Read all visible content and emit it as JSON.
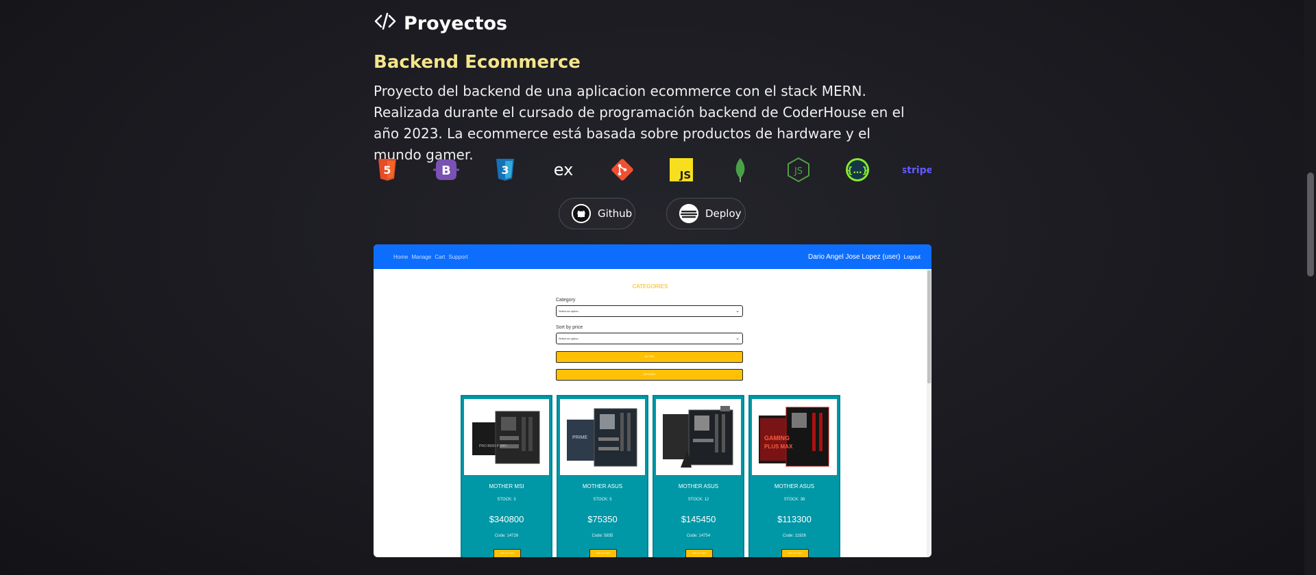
{
  "section": {
    "title": "Proyectos",
    "icon": "code-icon"
  },
  "project": {
    "title": "Backend Ecommerce",
    "description": "Proyecto del backend de una aplicacion ecommerce con el stack MERN. Realizada durante el cursado de programación backend de CoderHouse en el año 2023. La ecommerce está basada sobre productos de hardware y el mundo gamer.",
    "title_color": "#f5e58a",
    "technologies": [
      {
        "name": "html5-icon",
        "label": "5",
        "color": "#e44d26"
      },
      {
        "name": "bootstrap-icon",
        "label": "B",
        "color": "#7952b3"
      },
      {
        "name": "css3-icon",
        "label": "3",
        "color": "#1572b6"
      },
      {
        "name": "express-icon",
        "label": "ex",
        "color": "#ffffff"
      },
      {
        "name": "git-icon",
        "label": "",
        "color": "#f05032"
      },
      {
        "name": "javascript-icon",
        "label": "JS",
        "color": "#f7df1e"
      },
      {
        "name": "mongodb-icon",
        "label": "",
        "color": "#47a248"
      },
      {
        "name": "nodejs-icon",
        "label": "JS",
        "color": "#539e43"
      },
      {
        "name": "swagger-icon",
        "label": "{…}",
        "color": "#85ea2d"
      },
      {
        "name": "stripe-icon",
        "label": "stripe",
        "color": "#635bff"
      }
    ],
    "buttons": {
      "github": "Github",
      "deploy": "Deploy"
    }
  },
  "preview": {
    "nav": {
      "links": [
        "Home",
        "Manage",
        "Cart",
        "Support"
      ],
      "user": "Dario Angel Jose Lopez (user)",
      "logout": "Logout",
      "color": "#0d6efd"
    },
    "categories_title": "CATEGORIES",
    "category_label": "Category",
    "category_placeholder": "Select an option",
    "sort_label": "Sort by price",
    "sort_placeholder": "Select an option",
    "filter_label": "FILTER",
    "return_label": "RETURN",
    "products": [
      {
        "name": "MOTHER MSI",
        "stock": "STOCK: 3",
        "price": "$340800",
        "code": "Code: 14726",
        "buy": "ADD TO CART"
      },
      {
        "name": "MOTHER ASUS",
        "stock": "STOCK: 5",
        "price": "$75350",
        "code": "Code: 5835",
        "buy": "ADD TO CART"
      },
      {
        "name": "MOTHER ASUS",
        "stock": "STOCK: 12",
        "price": "$145450",
        "code": "Code: 14754",
        "buy": "ADD TO CART"
      },
      {
        "name": "MOTHER ASUS",
        "stock": "STOCK: 38",
        "price": "$113300",
        "code": "Code: 11926",
        "buy": "ADD TO CART"
      }
    ]
  }
}
